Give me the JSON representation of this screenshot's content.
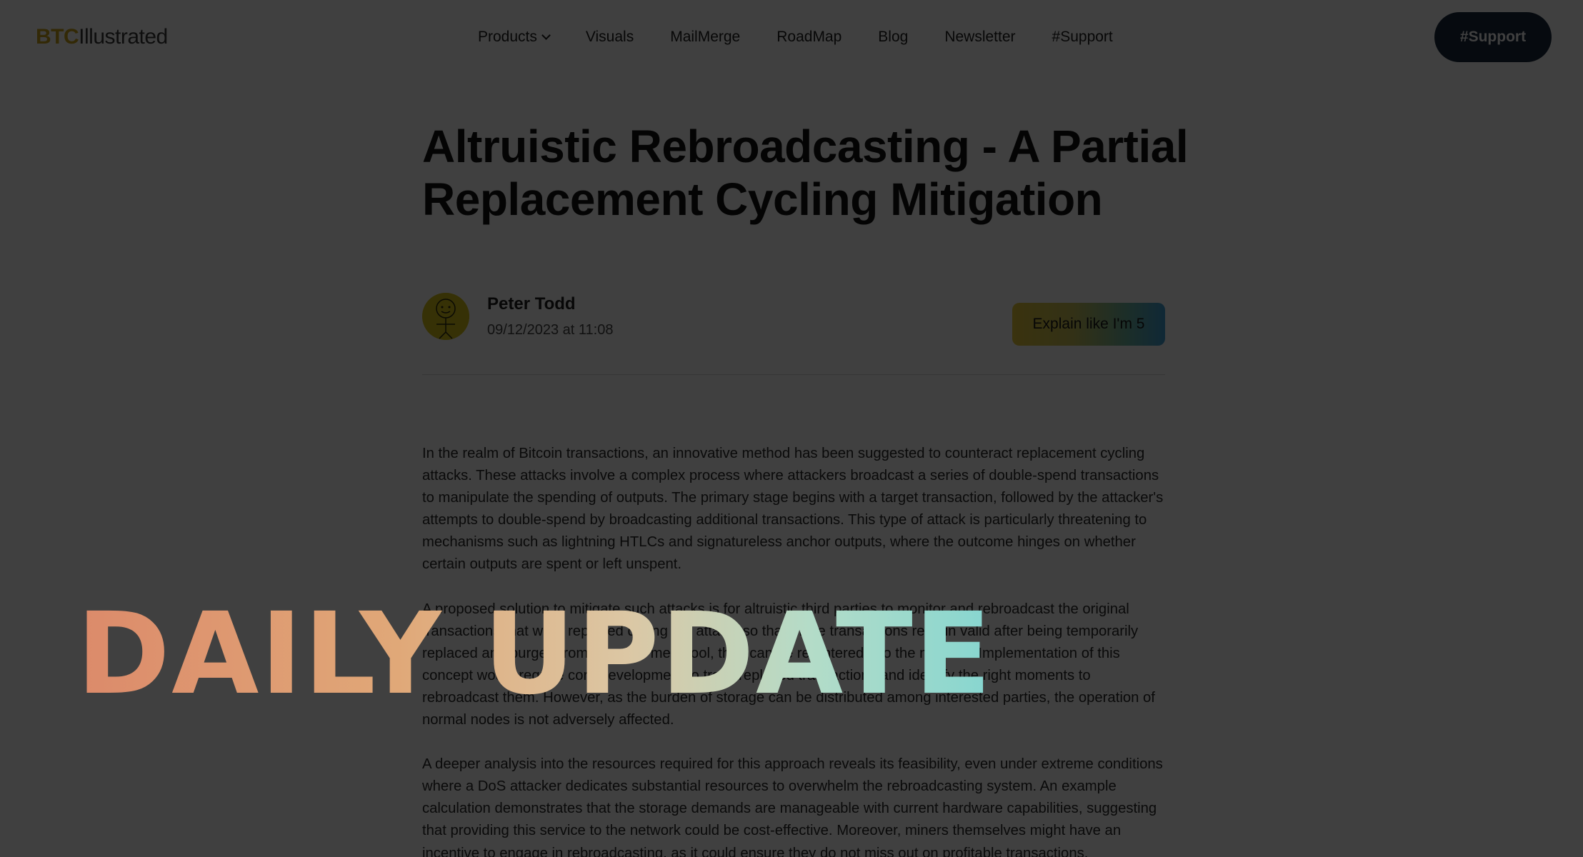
{
  "header": {
    "logo_btc": "BTC",
    "logo_rest": "Illustrated",
    "nav": [
      "Products",
      "Visuals",
      "MailMerge",
      "RoadMap",
      "Blog",
      "Newsletter",
      "#Support"
    ],
    "support_button": "#Support"
  },
  "article": {
    "title": "Altruistic Rebroadcasting - A Partial Replacement Cycling Mitigation",
    "author": "Peter Todd",
    "date": "09/12/2023 at 11:08",
    "eli5_button": "Explain like I'm 5",
    "paragraphs": [
      "In the realm of Bitcoin transactions, an innovative method has been suggested to counteract replacement cycling attacks. These attacks involve a complex process where attackers broadcast a series of double-spend transactions to manipulate the spending of outputs. The primary stage begins with a target transaction, followed by the attacker's attempts to double-spend by broadcasting additional transactions. This type of attack is particularly threatening to mechanisms such as lightning HTLCs and signatureless anchor outputs, where the outcome hinges on whether certain outputs are spent or left unspent.",
      "A proposed solution to mitigate such attacks is for altruistic third parties to monitor and rebroadcast the original transactions that were replaced during the attack, so that those transactions remain valid after being temporarily replaced and purged from a node's mempool, they can be re-entered into the network. Implementation of this concept would require core development to track replaced transactions and identify the right moments to rebroadcast them. However, as the burden of storage can be distributed among interested parties, the operation of normal nodes is not adversely affected.",
      "A deeper analysis into the resources required for this approach reveals its feasibility, even under extreme conditions where a DoS attacker dedicates substantial resources to overwhelm the rebroadcasting system. An example calculation demonstrates that the storage demands are manageable with current hardware capabilities, suggesting that providing this service to the network could be cost-effective. Moreover, miners themselves might have an incentive to engage in rebroadcasting, as it could ensure they do not miss out on profitable transactions."
    ]
  },
  "overlay": {
    "banner_text": "DAILY UPDATE"
  },
  "colors": {
    "logo_accent": "#c9a218",
    "support_button_bg": "#1a2a3f",
    "avatar_bg": "#d8c21a",
    "overlay_dim": "rgba(0,0,0,0.75)"
  },
  "icons": {
    "products_dropdown": "chevron-down-icon",
    "avatar": "smiley-face-avatar"
  }
}
